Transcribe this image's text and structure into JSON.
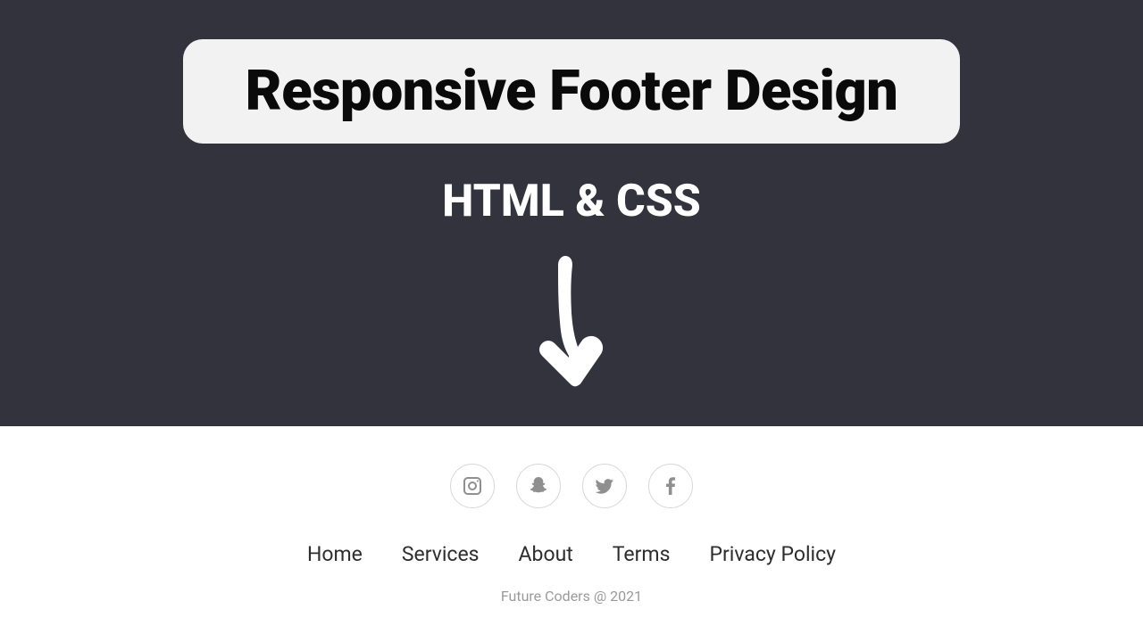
{
  "hero": {
    "title": "Responsive Footer Design",
    "subtitle": "HTML & CSS"
  },
  "footer": {
    "socials": [
      {
        "name": "instagram"
      },
      {
        "name": "snapchat"
      },
      {
        "name": "twitter"
      },
      {
        "name": "facebook"
      }
    ],
    "nav": [
      {
        "label": "Home"
      },
      {
        "label": "Services"
      },
      {
        "label": "About"
      },
      {
        "label": "Terms"
      },
      {
        "label": "Privacy Policy"
      }
    ],
    "copyright": "Future Coders @ 2021"
  }
}
